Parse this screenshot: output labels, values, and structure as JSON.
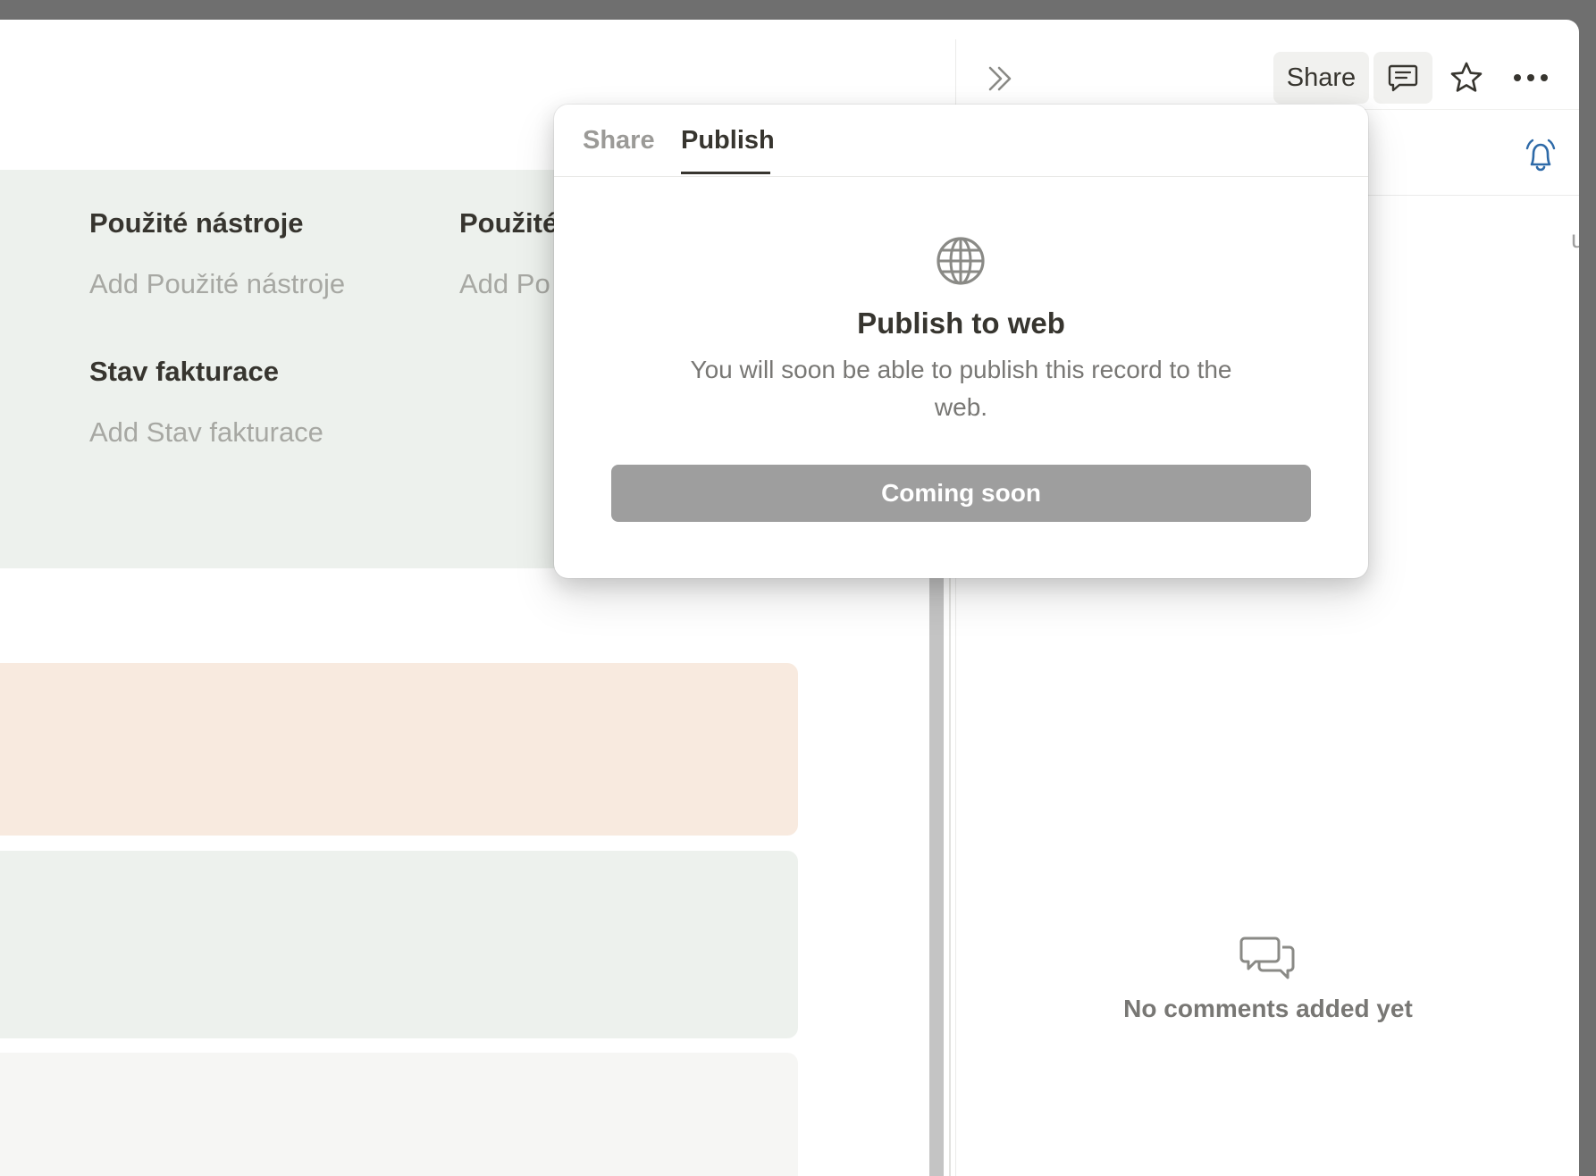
{
  "properties": {
    "row1": [
      {
        "label": "Použité nástroje",
        "add": "Add Použité nástroje"
      },
      {
        "label": "Použité",
        "add": "Add Po"
      }
    ],
    "row2": [
      {
        "label": "Stav fakturace",
        "add": "Add Stav fakturace"
      }
    ]
  },
  "toolbar": {
    "share_label": "Share",
    "icons": [
      "comment-icon",
      "star-icon",
      "more-icon"
    ]
  },
  "side_panel": {
    "clipped_text": "u",
    "empty_text": "No comments added yet",
    "icons": [
      "collapse-double-chevron-icon",
      "bell-icon",
      "comments-icon"
    ]
  },
  "popover": {
    "tabs": [
      {
        "label": "Share",
        "active": false
      },
      {
        "label": "Publish",
        "active": true
      }
    ],
    "title": "Publish to web",
    "description": "You will soon be able to publish this record to the web.",
    "button_label": "Coming soon",
    "icon": "globe-icon"
  },
  "colors": {
    "window_bg": "#6f6f6f",
    "card_green": "#edf1ed",
    "card_peach": "#f8eadf",
    "card_gray": "#f6f6f4",
    "button_disabled": "#9e9e9e",
    "bell_accent": "#2e6aa8"
  }
}
